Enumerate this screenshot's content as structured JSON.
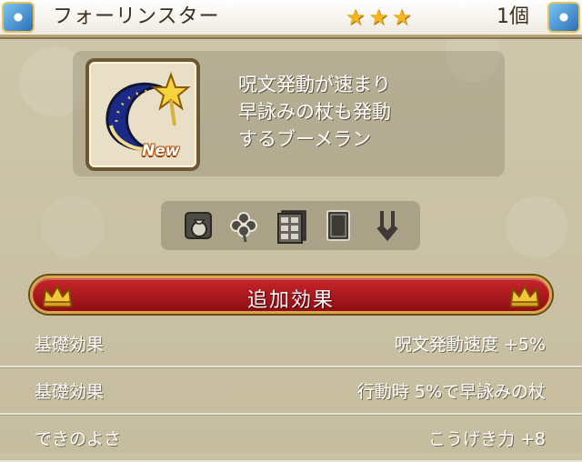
{
  "header": {
    "title": "フォーリンスター",
    "rarity_stars": 3,
    "count": "1個"
  },
  "item": {
    "icon": "star-boomerang-icon",
    "badge": "New",
    "description": [
      "呪文発動が速まり",
      "早詠みの杖も発動",
      "するブーメラン"
    ]
  },
  "equip_icons": [
    "money-bag-icon",
    "clover-icon",
    "cabinet-icon",
    "book-icon",
    "arrow-split-icon"
  ],
  "banner": {
    "title": "追加効果"
  },
  "effects": [
    {
      "label": "基礎効果",
      "value": "呪文発動速度 +5%"
    },
    {
      "label": "基礎効果",
      "value": "行動時 5%で早詠みの杖"
    },
    {
      "label": "できのよさ",
      "value": "こうげき力 +8"
    }
  ],
  "colors": {
    "banner_red": "#b51a1f",
    "star_gold": "#f2b51c",
    "frame_brown": "#6e5734"
  }
}
